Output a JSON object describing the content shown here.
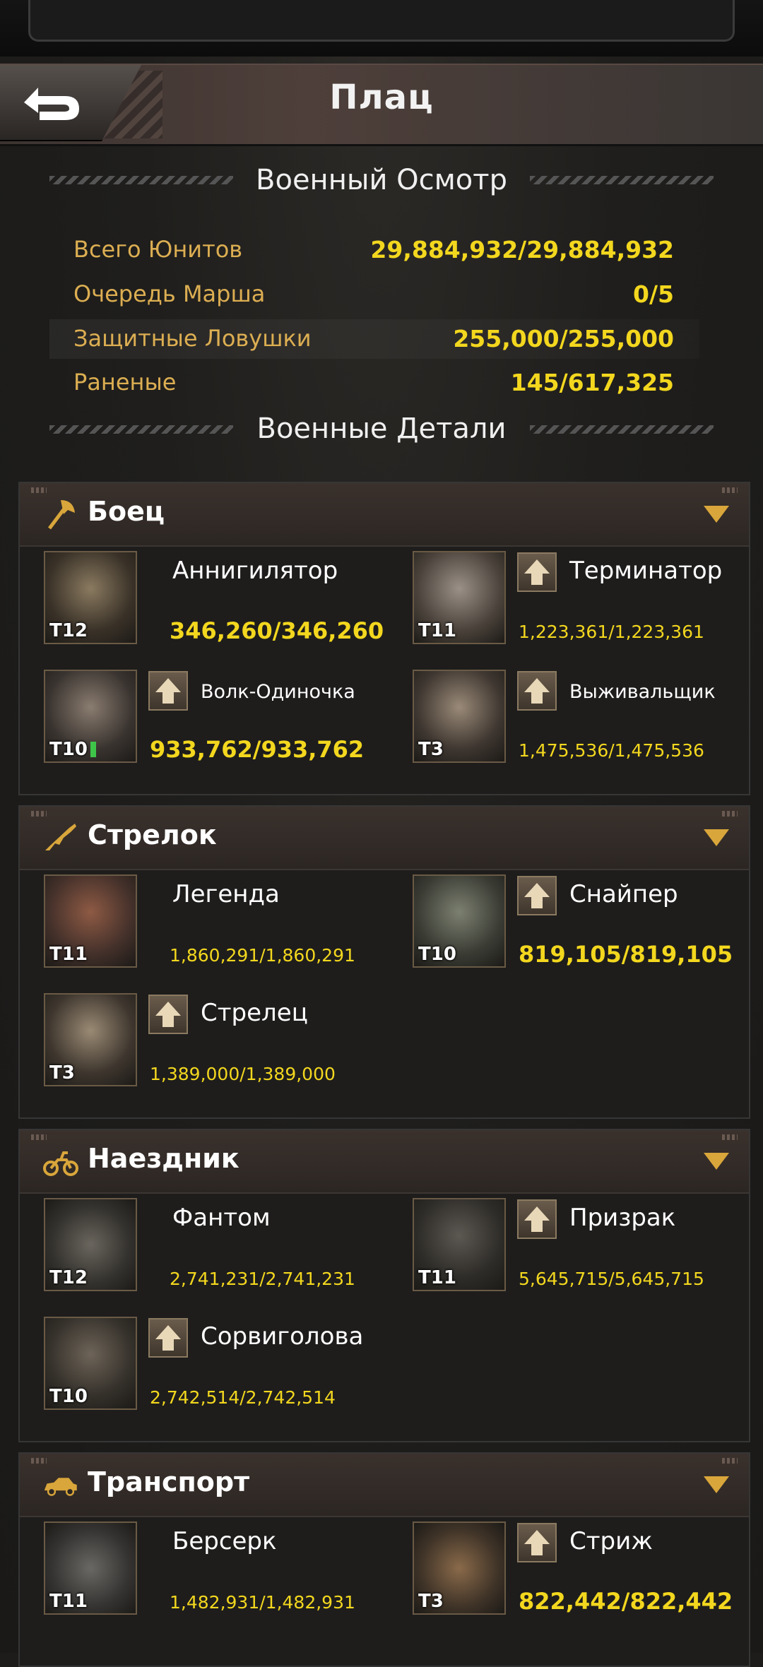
{
  "header": {
    "title": "Плац",
    "back_icon": "back-arrow-icon"
  },
  "overview": {
    "title": "Военный Осмотр",
    "rows": [
      {
        "label": "Всего Юнитов",
        "value": "29,884,932/29,884,932"
      },
      {
        "label": "Очередь Марша",
        "value": "0/5"
      },
      {
        "label": "Защитные Ловушки",
        "value": "255,000/255,000"
      },
      {
        "label": "Раненые",
        "value": "145/617,325"
      }
    ]
  },
  "details": {
    "title": "Военные Детали",
    "categories": [
      {
        "name": "Боец",
        "icon": "axe-icon",
        "units": [
          {
            "name": "Аннигилятор",
            "tier": "T12",
            "count": "346,260/346,260",
            "upgrade": false
          },
          {
            "name": "Терминатор",
            "tier": "T11",
            "count": "1,223,361/1,223,361",
            "upgrade": true
          },
          {
            "name": "Волк-Одиночка",
            "tier": "T10",
            "count": "933,762/933,762",
            "upgrade": true
          },
          {
            "name": "Выживальщик",
            "tier": "T3",
            "count": "1,475,536/1,475,536",
            "upgrade": true
          }
        ]
      },
      {
        "name": "Стрелок",
        "icon": "rifle-icon",
        "units": [
          {
            "name": "Легенда",
            "tier": "T11",
            "count": "1,860,291/1,860,291",
            "upgrade": false
          },
          {
            "name": "Снайпер",
            "tier": "T10",
            "count": "819,105/819,105",
            "upgrade": true
          },
          {
            "name": "Стрелец",
            "tier": "T3",
            "count": "1,389,000/1,389,000",
            "upgrade": true
          }
        ]
      },
      {
        "name": "Наездник",
        "icon": "motorcycle-icon",
        "units": [
          {
            "name": "Фантом",
            "tier": "T12",
            "count": "2,741,231/2,741,231",
            "upgrade": false
          },
          {
            "name": "Призрак",
            "tier": "T11",
            "count": "5,645,715/5,645,715",
            "upgrade": true
          },
          {
            "name": "Сорвиголова",
            "tier": "T10",
            "count": "2,742,514/2,742,514",
            "upgrade": true
          }
        ]
      },
      {
        "name": "Транспорт",
        "icon": "car-icon",
        "units": [
          {
            "name": "Берсерк",
            "tier": "T11",
            "count": "1,482,931/1,482,931",
            "upgrade": false
          },
          {
            "name": "Стриж",
            "tier": "T3",
            "count": "822,442/822,442",
            "upgrade": true
          }
        ]
      }
    ]
  },
  "colors": {
    "label_gold": "#dcae52",
    "value_yellow": "#f3d71e",
    "caret": "#d9a63b"
  }
}
